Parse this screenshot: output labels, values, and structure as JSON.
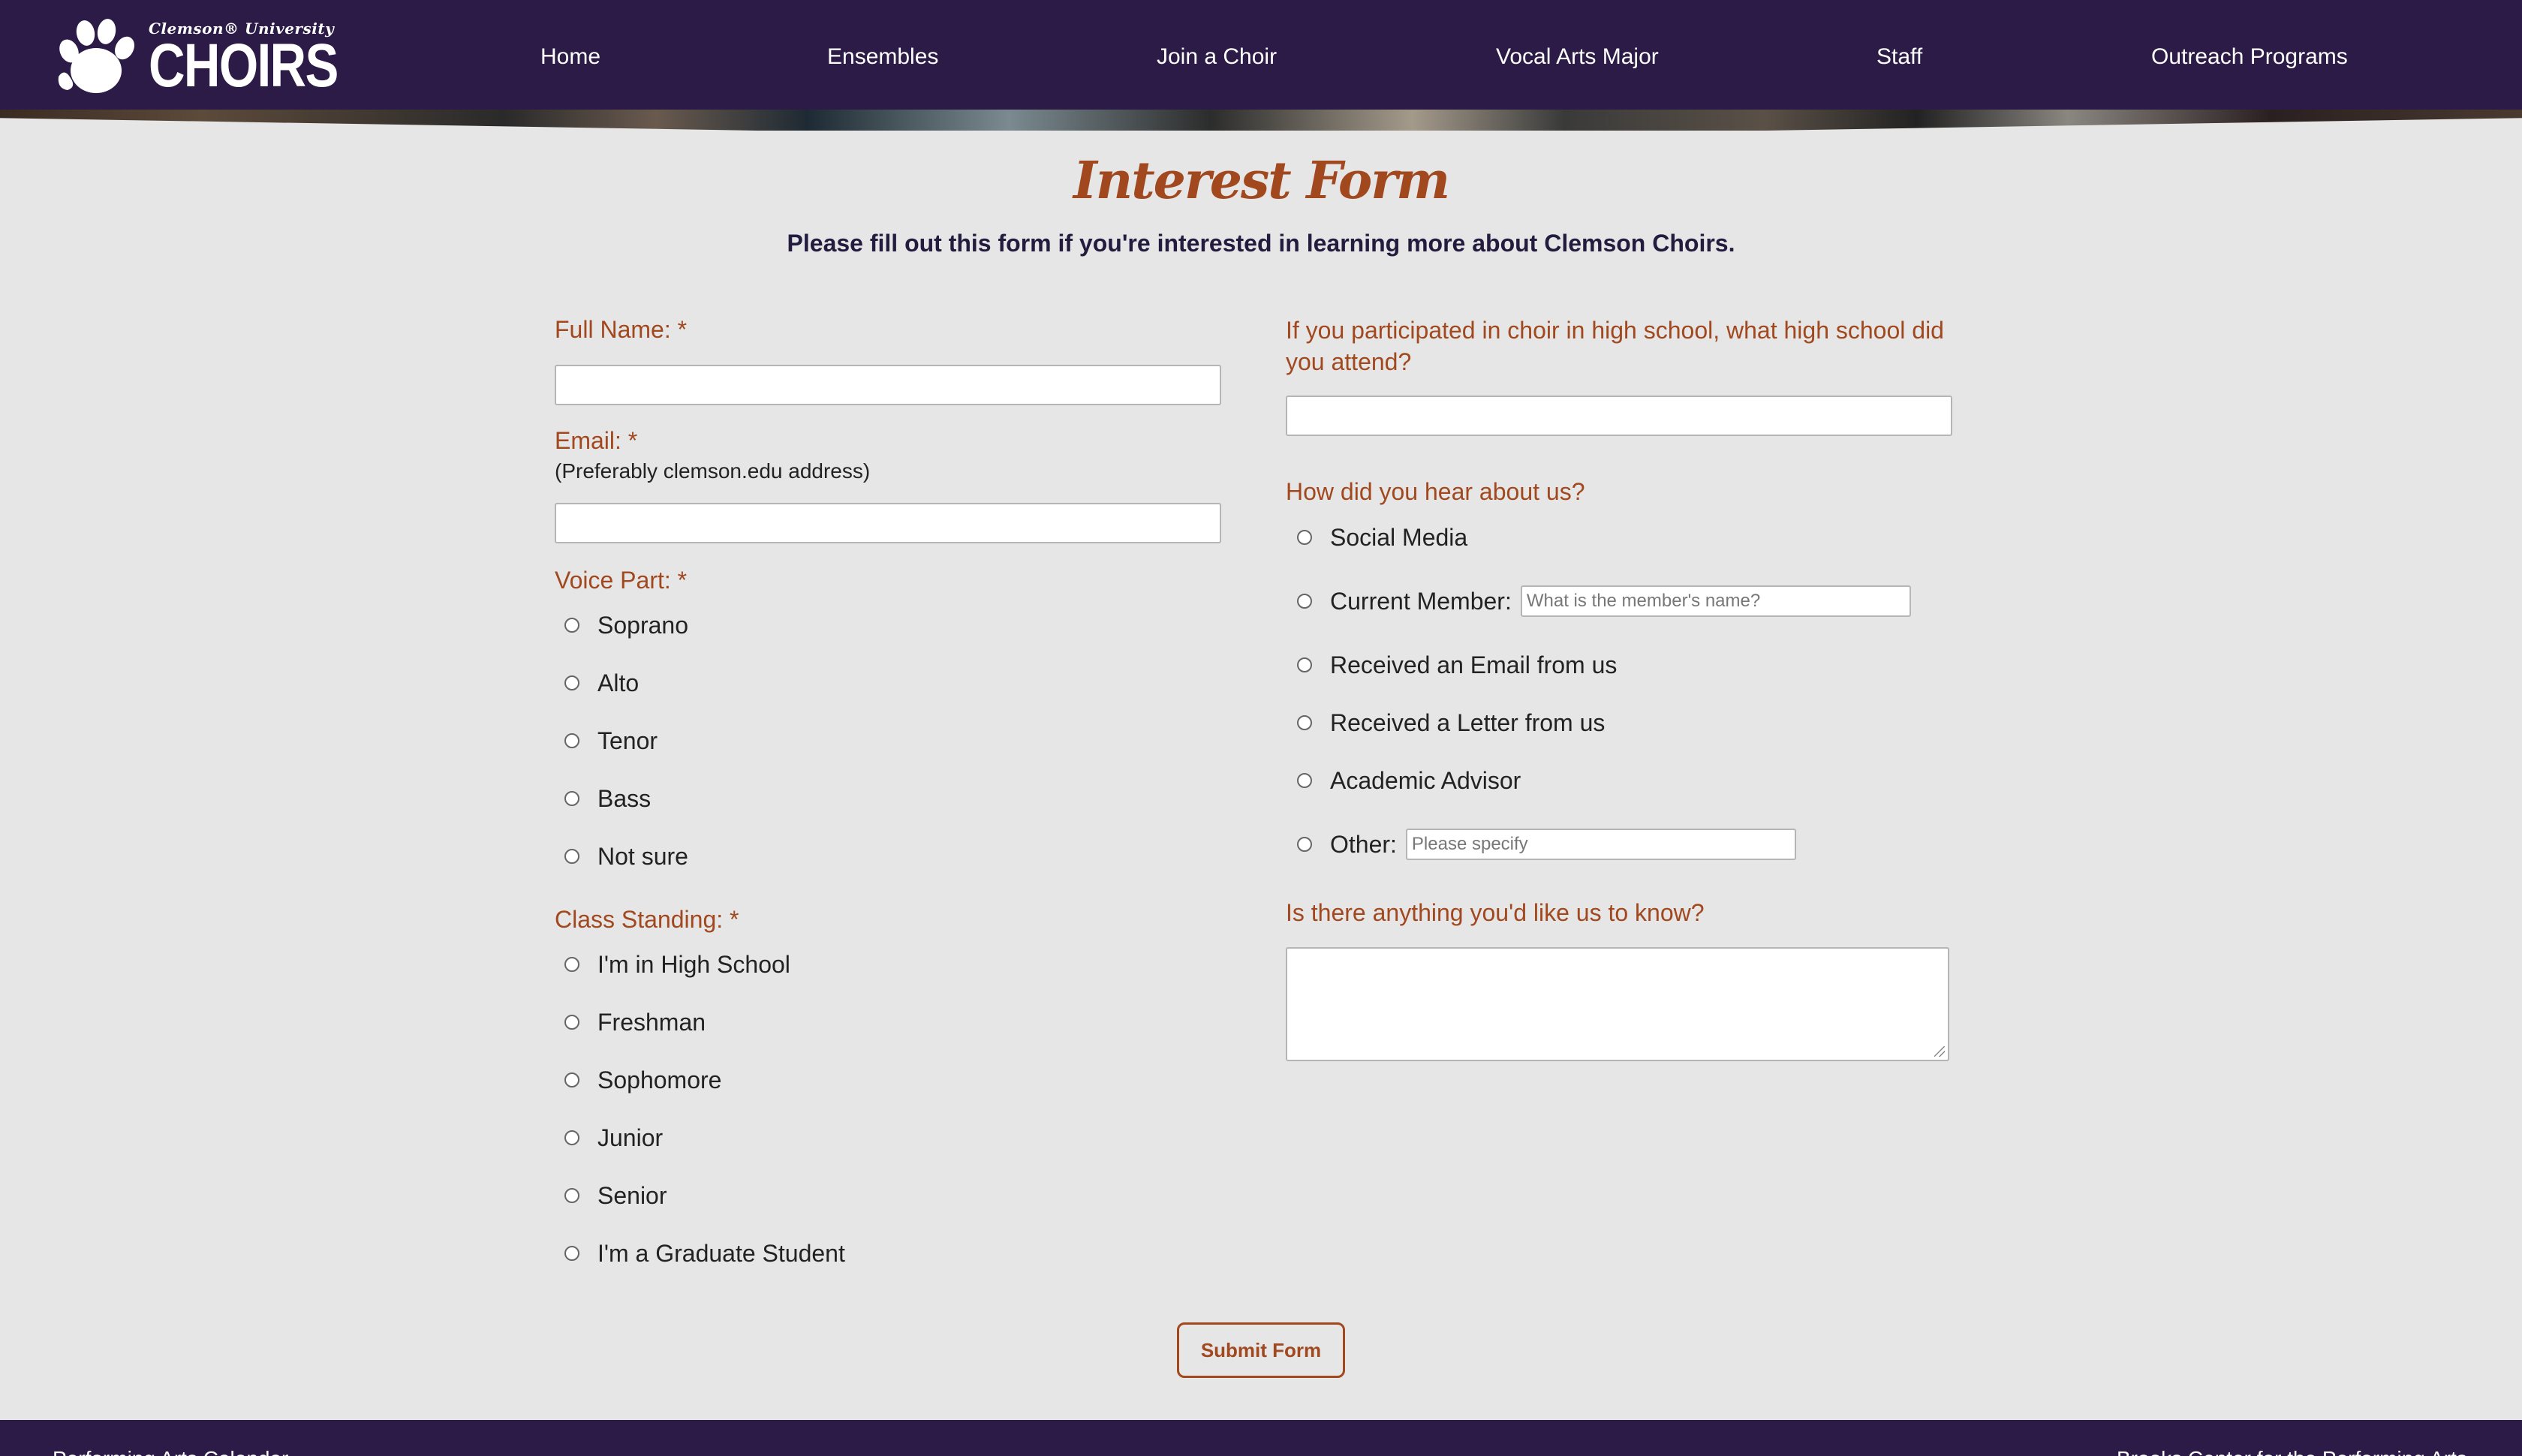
{
  "header": {
    "logo_small": "Clemson® University",
    "logo_big": "CHOIRS",
    "nav": [
      "Home",
      "Ensembles",
      "Join a Choir",
      "Vocal Arts Major",
      "Staff",
      "Outreach Programs"
    ]
  },
  "page": {
    "title": "Interest Form",
    "subtitle": "Please fill out this form if you're interested in learning more about Clemson Choirs."
  },
  "form": {
    "full_name_label": "Full Name: *",
    "email_label": "Email: *",
    "email_hint": "(Preferably clemson.edu address)",
    "voice_part_label": "Voice Part: *",
    "voice_parts": [
      "Soprano",
      "Alto",
      "Tenor",
      "Bass",
      "Not sure"
    ],
    "class_standing_label": "Class Standing: *",
    "class_standings": [
      "I'm in High School",
      "Freshman",
      "Sophomore",
      "Junior",
      "Senior",
      "I'm a Graduate Student"
    ],
    "high_school_label": "If you participated in choir in high school, what high school did you attend?",
    "hear_label": "How did you hear about us?",
    "hear_options": {
      "social_media": "Social Media",
      "current_member": "Current Member:",
      "current_member_placeholder": "What is the member's name?",
      "email": "Received an Email from us",
      "letter": "Received a Letter from us",
      "advisor": "Academic Advisor",
      "other": "Other:",
      "other_placeholder": "Please specify"
    },
    "anything_label": "Is there anything you'd like us to know?",
    "submit_label": "Submit Form"
  },
  "footer": {
    "left": "Performing Arts Calendar",
    "right": "Brooks Center for the Performing Arts"
  },
  "colors": {
    "header_bg": "#2b1b46",
    "accent": "#a1481e",
    "page_bg": "#e6e6e6"
  }
}
